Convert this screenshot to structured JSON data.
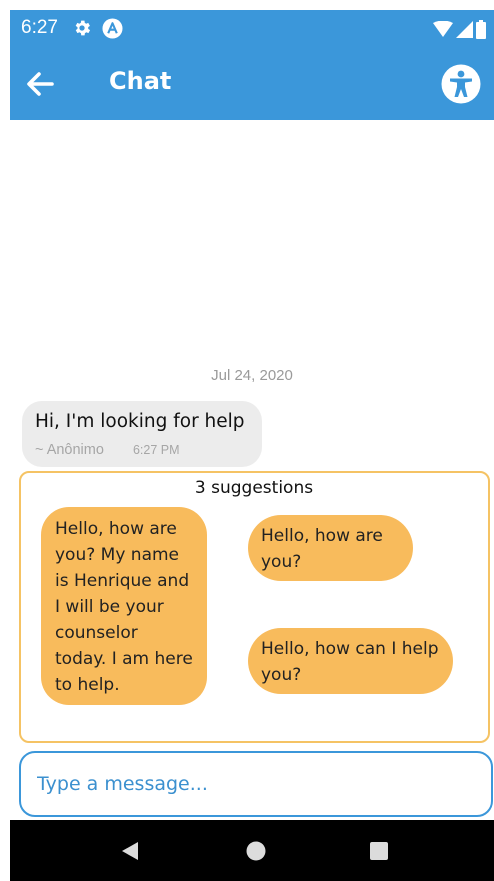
{
  "status_bar": {
    "time": "6:27",
    "icons": [
      "gear-icon",
      "a-badge-icon",
      "wifi-icon",
      "signal-icon",
      "battery-icon"
    ]
  },
  "app_bar": {
    "title": "Chat",
    "back_icon": "arrow-left-icon",
    "accessibility_icon": "accessibility-icon",
    "background_color": "#3b97da"
  },
  "chat": {
    "date_separator": "Jul 24, 2020",
    "messages": [
      {
        "text": "Hi, I'm looking for help",
        "author": "~ Anônimo",
        "time": "6:27 PM"
      }
    ]
  },
  "suggestions": {
    "title": "3 suggestions",
    "items": [
      "Hello, how are you? My name is Henrique and I will be your counselor today. I am here to help.",
      "Hello, how are you?",
      "Hello, how can I help you?"
    ],
    "accent_color": "#f8bb5c"
  },
  "composer": {
    "placeholder": "Type a message...",
    "value": ""
  },
  "nav_bar": {
    "icons": [
      "back-triangle-icon",
      "home-circle-icon",
      "recents-square-icon"
    ]
  }
}
